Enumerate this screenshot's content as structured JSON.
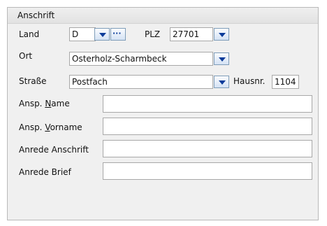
{
  "panel": {
    "title": "Anschrift"
  },
  "labels": {
    "land": "Land",
    "plz": "PLZ",
    "ort": "Ort",
    "strasse": "Straße",
    "hausnr": "Hausnr.",
    "ansp_name_prefix": "Ansp. ",
    "ansp_name_mnemonic": "N",
    "ansp_name_rest": "ame",
    "ansp_vorname_prefix": "Ansp. ",
    "ansp_vorname_mnemonic": "V",
    "ansp_vorname_rest": "orname",
    "anrede_anschrift": "Anrede Anschrift",
    "anrede_brief": "Anrede Brief"
  },
  "values": {
    "land": "D",
    "plz": "27701",
    "ort": "Osterholz-Scharmbeck",
    "strasse": "Postfach",
    "hausnr": "1104",
    "ansp_name": "",
    "ansp_vorname": "",
    "anrede_anschrift": "",
    "anrede_brief": ""
  },
  "buttons": {
    "more": "···"
  }
}
